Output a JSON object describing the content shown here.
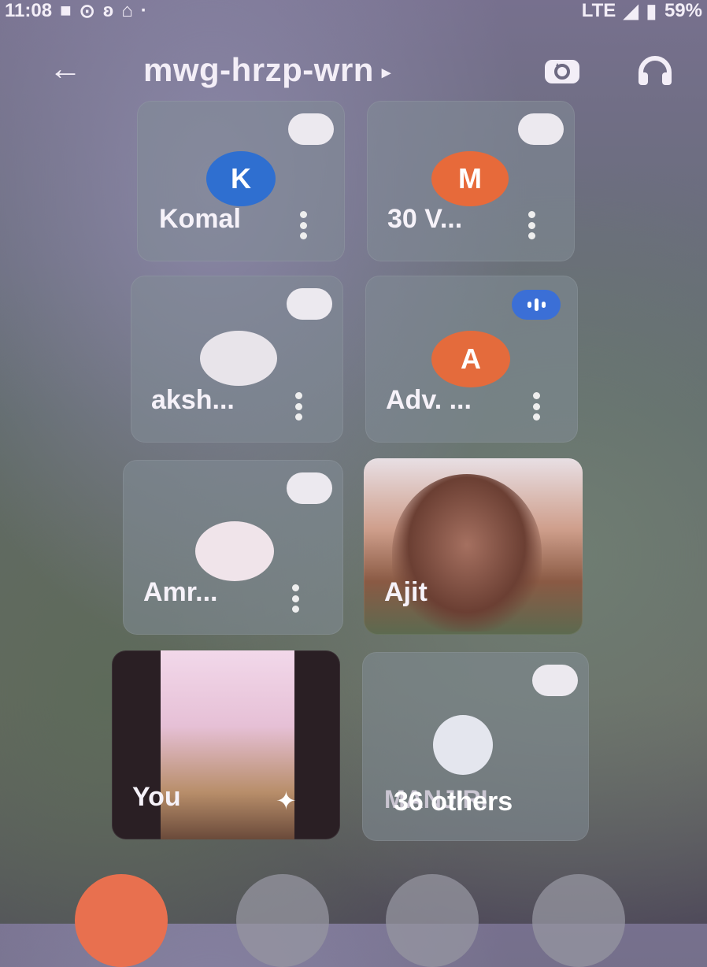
{
  "status_bar": {
    "time": "11:08",
    "battery": "59%",
    "network": "LTE"
  },
  "header": {
    "meeting_code": "mwg-hrzp-wrn"
  },
  "participants": [
    {
      "name": "Komal",
      "initial": "K",
      "avatar_color": "#2f6fd0",
      "muted": true
    },
    {
      "name": "30 V...",
      "initial": "M",
      "avatar_color": "#e76a3a",
      "muted": true
    },
    {
      "name": "aksh...",
      "initial": "",
      "avatar_color": "#e8e4ea",
      "muted": true
    },
    {
      "name": "Adv. ...",
      "initial": "A",
      "avatar_color": "#e46b3c",
      "muted": false,
      "speaking": true
    },
    {
      "name": "Amr...",
      "initial": "",
      "avatar_color": "#f0e4ea",
      "muted": true
    },
    {
      "name": "Ajit",
      "video": true
    },
    {
      "name": "You",
      "video": true,
      "self": true
    },
    {
      "name": "MANJIRI",
      "others_label": "36 others",
      "muted": true
    }
  ],
  "colors": {
    "mute_dot": "#ece9ef",
    "speaking": "#3b6fd6",
    "end_call": "#e86a4f"
  }
}
